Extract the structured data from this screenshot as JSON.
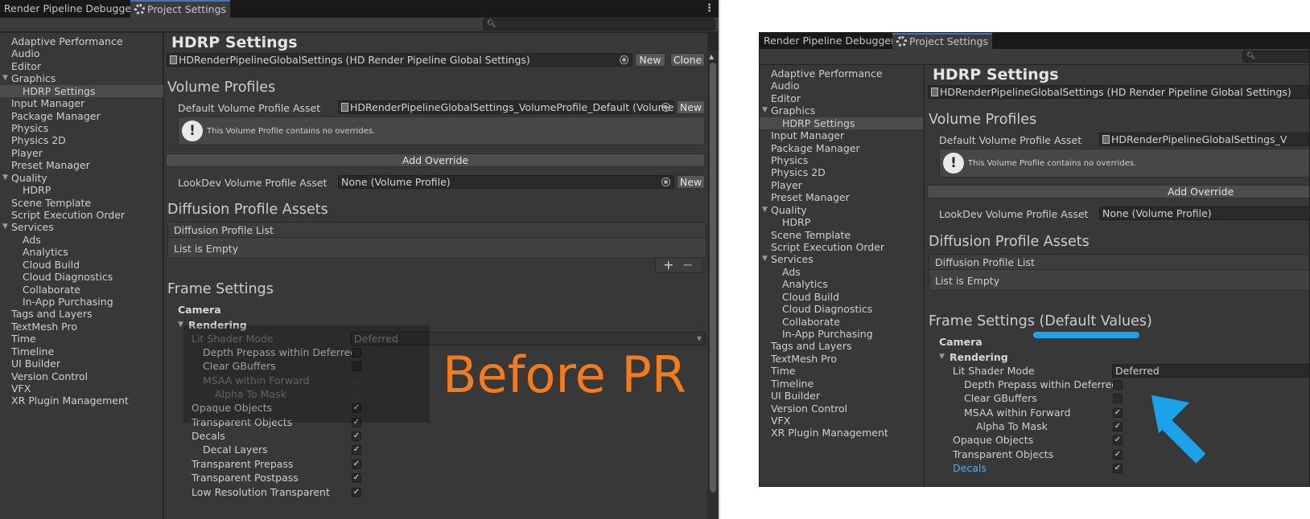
{
  "before": {
    "tabs": [
      {
        "label": "Render Pipeline Debugger"
      },
      {
        "label": "Project Settings",
        "icon": "gear-icon"
      }
    ],
    "sidebar": [
      {
        "label": "Adaptive Performance"
      },
      {
        "label": "Audio"
      },
      {
        "label": "Editor"
      },
      {
        "label": "Graphics",
        "expanded": true
      },
      {
        "label": "HDRP Settings",
        "selected": true
      },
      {
        "label": "Input Manager"
      },
      {
        "label": "Package Manager"
      },
      {
        "label": "Physics"
      },
      {
        "label": "Physics 2D"
      },
      {
        "label": "Player"
      },
      {
        "label": "Preset Manager"
      },
      {
        "label": "Quality",
        "expanded": true
      },
      {
        "label": "HDRP"
      },
      {
        "label": "Scene Template"
      },
      {
        "label": "Script Execution Order"
      },
      {
        "label": "Services",
        "expanded": true
      },
      {
        "label": "Ads"
      },
      {
        "label": "Analytics"
      },
      {
        "label": "Cloud Build"
      },
      {
        "label": "Cloud Diagnostics"
      },
      {
        "label": "Collaborate"
      },
      {
        "label": "In-App Purchasing"
      },
      {
        "label": "Tags and Layers"
      },
      {
        "label": "TextMesh Pro"
      },
      {
        "label": "Time"
      },
      {
        "label": "Timeline"
      },
      {
        "label": "UI Builder"
      },
      {
        "label": "Version Control"
      },
      {
        "label": "VFX"
      },
      {
        "label": "XR Plugin Management"
      }
    ],
    "title": "HDRP Settings",
    "global_settings_asset": "HDRenderPipelineGlobalSettings (HD Render Pipeline Global Settings)",
    "new_label": "New",
    "clone_label": "Clone",
    "volume_profiles_heading": "Volume Profiles",
    "default_volume_label": "Default Volume Profile Asset",
    "default_volume_value": "HDRenderPipelineGlobalSettings_VolumeProfile_Default (Volume Profile)",
    "no_overrides_text": "This Volume Profile contains no overrides.",
    "add_override_label": "Add Override",
    "lookdev_label": "LookDev Volume Profile Asset",
    "lookdev_value": "None (Volume Profile)",
    "diffusion_heading": "Diffusion Profile Assets",
    "diffusion_list_header": "Diffusion Profile List",
    "list_empty": "List is Empty",
    "plus": "+",
    "minus": "−",
    "frame_settings_heading": "Frame Settings",
    "camera_label": "Camera",
    "rendering_label": "Rendering",
    "lit_shader_label": "Lit Shader Mode",
    "lit_shader_value": "Deferred",
    "frame_rows": [
      {
        "label": "Depth Prepass within Deferred",
        "checked": false,
        "enabled": true
      },
      {
        "label": "Clear GBuffers",
        "checked": false,
        "enabled": true
      },
      {
        "label": "MSAA within Forward",
        "checked": false,
        "enabled": false
      },
      {
        "label": "Alpha To Mask",
        "checked": false,
        "enabled": false
      },
      {
        "label": "Opaque Objects",
        "checked": true,
        "enabled": true
      },
      {
        "label": "Transparent Objects",
        "checked": true,
        "enabled": true
      },
      {
        "label": "Decals",
        "checked": true,
        "enabled": true
      },
      {
        "label": "Decal Layers",
        "checked": true,
        "enabled": true
      },
      {
        "label": "Transparent Prepass",
        "checked": true,
        "enabled": true
      },
      {
        "label": "Transparent Postpass",
        "checked": true,
        "enabled": true
      },
      {
        "label": "Low Resolution Transparent",
        "checked": true,
        "enabled": true
      }
    ],
    "annotation": "Before PR",
    "annotation_color": "#f27b20"
  },
  "after": {
    "tabs": [
      {
        "label": "Render Pipeline Debugger"
      },
      {
        "label": "Project Settings",
        "icon": "gear-icon"
      }
    ],
    "sidebar": [
      {
        "label": "Adaptive Performance"
      },
      {
        "label": "Audio"
      },
      {
        "label": "Editor"
      },
      {
        "label": "Graphics",
        "expanded": true
      },
      {
        "label": "HDRP Settings",
        "selected": true
      },
      {
        "label": "Input Manager"
      },
      {
        "label": "Package Manager"
      },
      {
        "label": "Physics"
      },
      {
        "label": "Physics 2D"
      },
      {
        "label": "Player"
      },
      {
        "label": "Preset Manager"
      },
      {
        "label": "Quality",
        "expanded": true
      },
      {
        "label": "HDRP"
      },
      {
        "label": "Scene Template"
      },
      {
        "label": "Script Execution Order"
      },
      {
        "label": "Services",
        "expanded": true
      },
      {
        "label": "Ads"
      },
      {
        "label": "Analytics"
      },
      {
        "label": "Cloud Build"
      },
      {
        "label": "Cloud Diagnostics"
      },
      {
        "label": "Collaborate"
      },
      {
        "label": "In-App Purchasing"
      },
      {
        "label": "Tags and Layers"
      },
      {
        "label": "TextMesh Pro"
      },
      {
        "label": "Time"
      },
      {
        "label": "Timeline"
      },
      {
        "label": "UI Builder"
      },
      {
        "label": "Version Control"
      },
      {
        "label": "VFX"
      },
      {
        "label": "XR Plugin Management"
      }
    ],
    "title": "HDRP Settings",
    "global_settings_asset": "HDRenderPipelineGlobalSettings (HD Render Pipeline Global Settings)",
    "volume_profiles_heading": "Volume Profiles",
    "default_volume_label": "Default Volume Profile Asset",
    "default_volume_value": "HDRenderPipelineGlobalSettings_V",
    "no_overrides_text": "This Volume Profile contains no overrides.",
    "add_override_label": "Add Override",
    "lookdev_label": "LookDev Volume Profile Asset",
    "lookdev_value": "None (Volume Profile)",
    "diffusion_heading": "Diffusion Profile Assets",
    "diffusion_list_header": "Diffusion Profile List",
    "list_empty": "List is Empty",
    "frame_settings_heading": "Frame Settings",
    "frame_settings_suffix": "(Default Values)",
    "camera_label": "Camera",
    "rendering_label": "Rendering",
    "lit_shader_label": "Lit Shader Mode",
    "lit_shader_value": "Deferred",
    "frame_rows": [
      {
        "label": "Depth Prepass within Deferred",
        "checked": false
      },
      {
        "label": "Clear GBuffers",
        "checked": false
      },
      {
        "label": "MSAA within Forward",
        "checked": true
      },
      {
        "label": "Alpha To Mask",
        "checked": true
      },
      {
        "label": "Opaque Objects",
        "checked": true
      },
      {
        "label": "Transparent Objects",
        "checked": true
      },
      {
        "label": "Decals",
        "checked": true
      }
    ],
    "highlight_color": "#1aa3e8"
  }
}
